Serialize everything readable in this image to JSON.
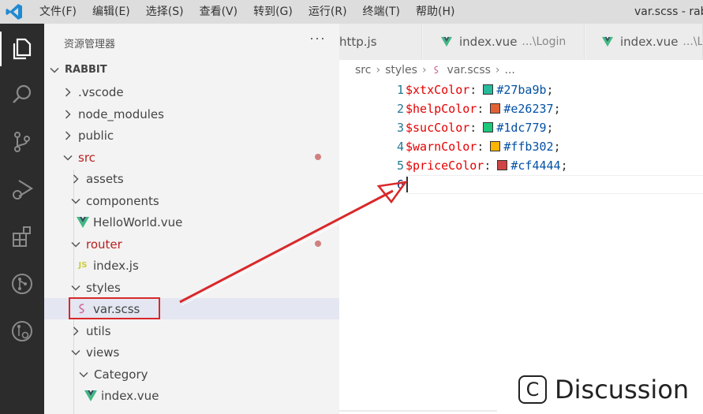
{
  "titlebar": {
    "menu": [
      "文件(F)",
      "编辑(E)",
      "选择(S)",
      "查看(V)",
      "转到(G)",
      "运行(R)",
      "终端(T)",
      "帮助(H)"
    ],
    "window_title": "var.scss - rab"
  },
  "activity_bar": {
    "items": [
      "explorer-icon",
      "search-icon",
      "source-control-icon",
      "run-debug-icon",
      "extensions-icon",
      "git-graph-icon",
      "remote-icon"
    ]
  },
  "sidebar": {
    "title": "资源管理器",
    "more": "···",
    "root": "RABBIT",
    "tree": [
      {
        "label": ".vscode",
        "type": "folder",
        "expanded": false
      },
      {
        "label": "node_modules",
        "type": "folder",
        "expanded": false
      },
      {
        "label": "public",
        "type": "folder",
        "expanded": false
      },
      {
        "label": "src",
        "type": "folder",
        "expanded": true,
        "modified": true
      },
      {
        "label": "assets",
        "type": "folder",
        "expanded": false
      },
      {
        "label": "components",
        "type": "folder",
        "expanded": true
      },
      {
        "label": "HelloWorld.vue",
        "type": "vue"
      },
      {
        "label": "router",
        "type": "folder",
        "expanded": true,
        "modified": true
      },
      {
        "label": "index.js",
        "type": "js",
        "icon_text": "JS"
      },
      {
        "label": "styles",
        "type": "folder",
        "expanded": true
      },
      {
        "label": "var.scss",
        "type": "scss",
        "selected": true
      },
      {
        "label": "utils",
        "type": "folder",
        "expanded": false
      },
      {
        "label": "views",
        "type": "folder",
        "expanded": true
      },
      {
        "label": "Category",
        "type": "folder",
        "expanded": true
      },
      {
        "label": "index.vue",
        "type": "vue"
      }
    ]
  },
  "tabs": [
    {
      "label": "http.js",
      "desc": ""
    },
    {
      "label": "index.vue",
      "desc": "...\\Login"
    },
    {
      "label": "index.vue",
      "desc": "...\\Lay"
    }
  ],
  "breadcrumb": [
    "src",
    "styles",
    "var.scss",
    "..."
  ],
  "code": [
    {
      "n": "1",
      "var": "$xtxColor",
      "hex": "#27ba9b",
      "color": "#27ba9b"
    },
    {
      "n": "2",
      "var": "$helpColor",
      "hex": "#e26237",
      "color": "#e26237"
    },
    {
      "n": "3",
      "var": "$sucColor",
      "hex": "#1dc779",
      "color": "#1dc779"
    },
    {
      "n": "4",
      "var": "$warnColor",
      "hex": "#ffb302",
      "color": "#ffb302"
    },
    {
      "n": "5",
      "var": "$priceColor",
      "hex": "#cf4444",
      "color": "#cf4444"
    },
    {
      "n": "6"
    }
  ],
  "annotation": {
    "color": "#d9282a"
  },
  "watermark": {
    "icon": "C",
    "text": "Discussion"
  }
}
